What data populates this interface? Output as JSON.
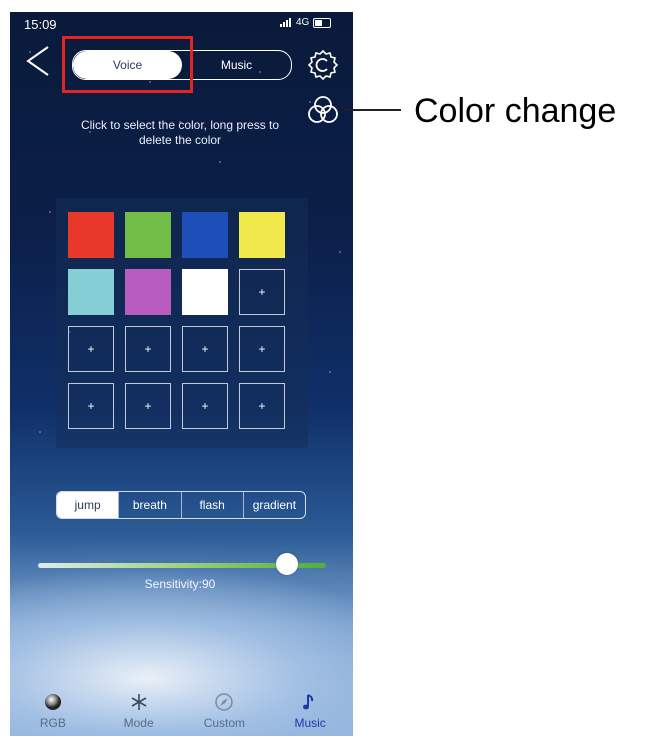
{
  "status": {
    "time": "15:09",
    "signal": "4G"
  },
  "header": {
    "tabs": [
      {
        "label": "Voice",
        "active": true
      },
      {
        "label": "Music",
        "active": false
      }
    ],
    "back_icon": "chevron-left-icon",
    "settings_icon": "gear-icon",
    "color_change_icon": "rings-icon"
  },
  "annotation": {
    "label": "Color change",
    "highlight_color": "#e52421"
  },
  "hint": "Click to select the color, long press to delete the color",
  "swatches": [
    {
      "color": "#e8382c"
    },
    {
      "color": "#71bd48"
    },
    {
      "color": "#1e4fb8"
    },
    {
      "color": "#efe94b"
    },
    {
      "color": "#86ced6"
    },
    {
      "color": "#b85cbf"
    },
    {
      "color": "#ffffff"
    }
  ],
  "add_slot_label": "+",
  "modes": [
    {
      "label": "jump",
      "active": true
    },
    {
      "label": "breath",
      "active": false
    },
    {
      "label": "flash",
      "active": false
    },
    {
      "label": "gradient",
      "active": false
    }
  ],
  "sensitivity": {
    "label": "Sensitivity:90",
    "value": 90,
    "max": 100
  },
  "tabs": [
    {
      "label": "RGB",
      "icon": "rgb-icon",
      "active": false
    },
    {
      "label": "Mode",
      "icon": "snowflake-icon",
      "active": false
    },
    {
      "label": "Custom",
      "icon": "compass-icon",
      "active": false
    },
    {
      "label": "Music",
      "icon": "music-note-icon",
      "active": true
    }
  ],
  "colors": {
    "active_tab": "#1b3aa8",
    "inactive_tab": "#5a6b82"
  }
}
